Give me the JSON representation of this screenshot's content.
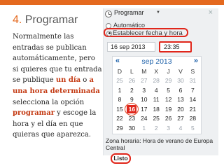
{
  "slide": {
    "number": "4.",
    "title": "Programar",
    "body_part1": "Normalmente las entradas se publican automáticamente, pero si quieres que tu entrada se publique ",
    "highlight_1": "un día",
    "connector": " o ",
    "highlight_2": "a una hora determinada",
    "body_part2": " selecciona la opción ",
    "highlight_3": "programar",
    "body_part3": " y escoge la hora y el día en que quieras que aparezca."
  },
  "panel": {
    "header_label": "Programar",
    "close_icon": "×",
    "option_auto": "Automático",
    "option_set": "Establecer fecha y hora",
    "date_value": "16 sep 2013",
    "time_value": "23:35",
    "calendar": {
      "month_label": "sep 2013",
      "prev_label": "«",
      "next_label": "»",
      "weekdays": [
        "D",
        "L",
        "M",
        "X",
        "J",
        "V",
        "S"
      ],
      "weeks": [
        [
          "25",
          "26",
          "27",
          "28",
          "29",
          "30",
          "31"
        ],
        [
          "1",
          "2",
          "3",
          "4",
          "5",
          "6",
          "7"
        ],
        [
          "8",
          "9",
          "10",
          "11",
          "12",
          "13",
          "14"
        ],
        [
          "15",
          "16",
          "17",
          "18",
          "19",
          "20",
          "21"
        ],
        [
          "22",
          "23",
          "24",
          "25",
          "26",
          "27",
          "28"
        ],
        [
          "29",
          "30",
          "1",
          "2",
          "3",
          "4",
          "5"
        ]
      ],
      "selected_day": "16"
    },
    "timezone": "Zona horaria: Hora de verano de Europa Central",
    "done_button": "Listo"
  },
  "colors": {
    "accent_top": "#e4691f",
    "highlight_text": "#c43b14",
    "selection_red": "#e0261b",
    "calendar_blue": "#1b5fa8"
  }
}
